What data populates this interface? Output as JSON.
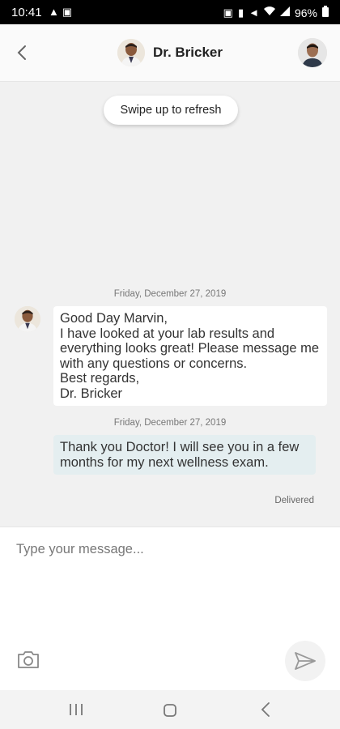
{
  "status_bar": {
    "time": "10:41",
    "battery": "96%",
    "left_icons": [
      "notification-icon",
      "image-icon"
    ],
    "right_icons": [
      "nfc-icon",
      "vibrate-icon",
      "mute-icon",
      "wifi-icon",
      "signal-icon",
      "battery-icon"
    ]
  },
  "header": {
    "doctor_name": "Dr. Bricker"
  },
  "refresh_hint": "Swipe up to refresh",
  "conversation": {
    "messages": [
      {
        "date": "Friday, December 27, 2019",
        "direction": "incoming",
        "text": "Good Day Marvin,\nI have looked at your lab results and everything looks great! Please message me with any questions or concerns.\nBest regards,\nDr. Bricker"
      },
      {
        "date": "Friday, December 27, 2019",
        "direction": "outgoing",
        "text": "Thank you Doctor! I will see you in a few months for my next wellness exam.",
        "status": "Delivered"
      }
    ]
  },
  "composer": {
    "placeholder": "Type your message..."
  },
  "colors": {
    "background": "#f1f1f1",
    "incoming_bubble": "#ffffff",
    "outgoing_bubble": "#e4eef0",
    "status_bar": "#000000"
  }
}
